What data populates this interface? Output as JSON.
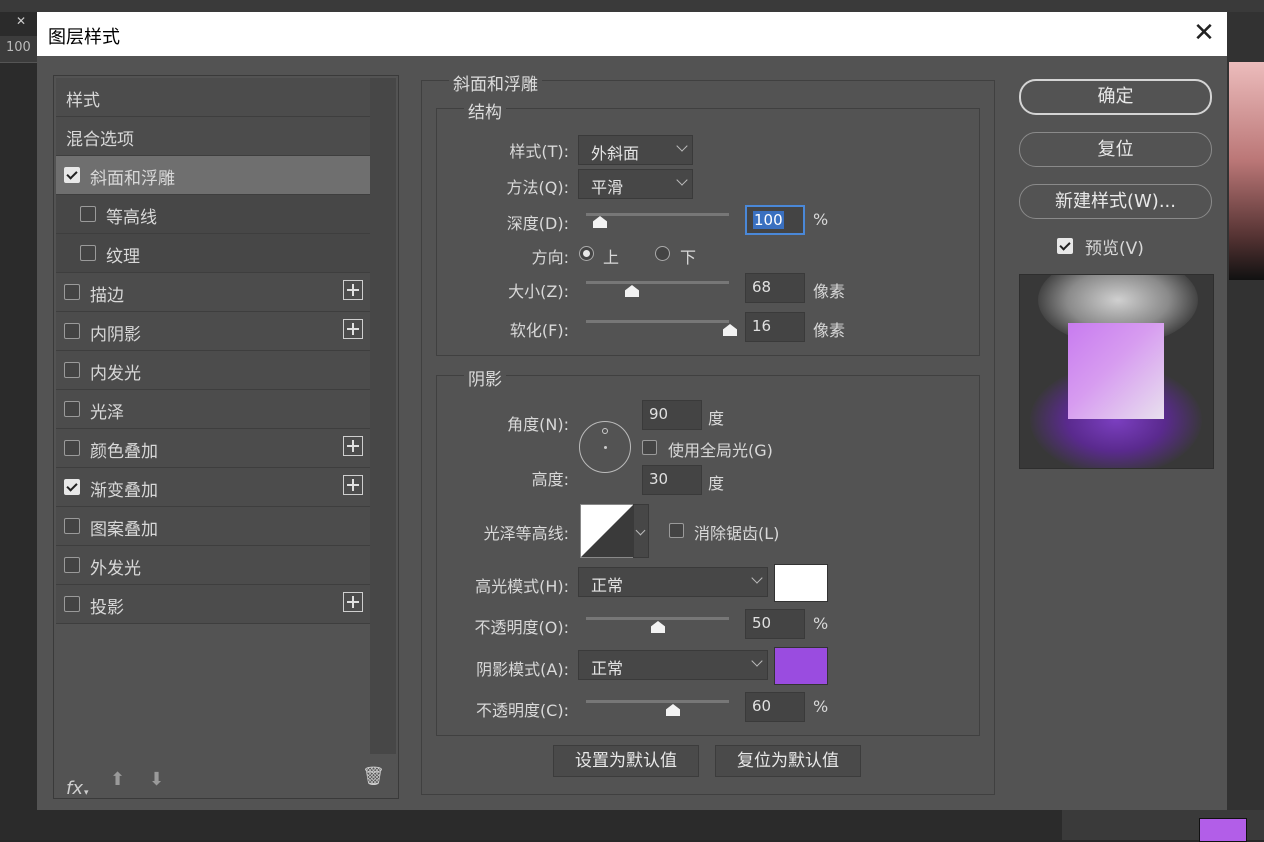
{
  "background": {
    "ruler_value": "100",
    "close_glyph": "✕"
  },
  "dialog": {
    "title": "图层样式",
    "close_label": "✕"
  },
  "left_panel": {
    "items": [
      {
        "label": "样式",
        "type": "header"
      },
      {
        "label": "混合选项",
        "type": "header"
      },
      {
        "label": "斜面和浮雕",
        "checked": true,
        "selected": true,
        "plus": false
      },
      {
        "label": "等高线",
        "checked": false,
        "sub": true
      },
      {
        "label": "纹理",
        "checked": false,
        "sub": true
      },
      {
        "label": "描边",
        "checked": false,
        "plus": true
      },
      {
        "label": "内阴影",
        "checked": false,
        "plus": true
      },
      {
        "label": "内发光",
        "checked": false,
        "plus": false
      },
      {
        "label": "光泽",
        "checked": false,
        "plus": false
      },
      {
        "label": "颜色叠加",
        "checked": false,
        "plus": true
      },
      {
        "label": "渐变叠加",
        "checked": true,
        "plus": true
      },
      {
        "label": "图案叠加",
        "checked": false,
        "plus": false
      },
      {
        "label": "外发光",
        "checked": false,
        "plus": false
      },
      {
        "label": "投影",
        "checked": false,
        "plus": true
      }
    ],
    "fx_label": "fx",
    "up_glyph": "⬆",
    "down_glyph": "⬇",
    "trash_glyph": "🗑"
  },
  "bevel": {
    "section_title": "斜面和浮雕",
    "structure": {
      "title": "结构",
      "style_label": "样式(T):",
      "style_value": "外斜面",
      "method_label": "方法(Q):",
      "method_value": "平滑",
      "depth_label": "深度(D):",
      "depth_value": "100",
      "depth_unit": "%",
      "direction_label": "方向:",
      "dir_up": "上",
      "dir_down": "下",
      "direction_selected": "上",
      "size_label": "大小(Z):",
      "size_value": "68",
      "size_unit": "像素",
      "soften_label": "软化(F):",
      "soften_value": "16",
      "soften_unit": "像素"
    },
    "shading": {
      "title": "阴影",
      "angle_label": "角度(N):",
      "angle_value": "90",
      "angle_unit": "度",
      "global_light_label": "使用全局光(G)",
      "global_light_checked": false,
      "altitude_label": "高度:",
      "altitude_value": "30",
      "altitude_unit": "度",
      "gloss_contour_label": "光泽等高线:",
      "anti_alias_label": "消除锯齿(L)",
      "anti_alias_checked": false,
      "highlight_mode_label": "高光模式(H):",
      "highlight_mode_value": "正常",
      "highlight_color": "#ffffff",
      "highlight_opacity_label": "不透明度(O):",
      "highlight_opacity_value": "50",
      "highlight_opacity_unit": "%",
      "shadow_mode_label": "阴影模式(A):",
      "shadow_mode_value": "正常",
      "shadow_color": "#9a4ce0",
      "shadow_opacity_label": "不透明度(C):",
      "shadow_opacity_value": "60",
      "shadow_opacity_unit": "%"
    },
    "make_default_label": "设置为默认值",
    "reset_default_label": "复位为默认值"
  },
  "right": {
    "ok_label": "确定",
    "reset_label": "复位",
    "new_style_label": "新建样式(W)...",
    "preview_label": "预览(V)",
    "preview_checked": true
  }
}
